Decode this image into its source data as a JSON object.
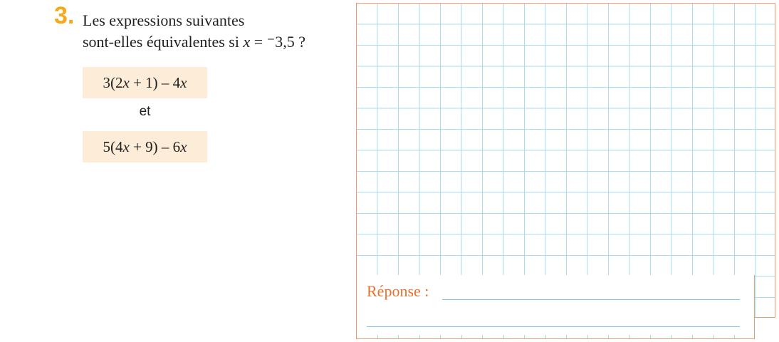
{
  "exercise": {
    "number": "3.",
    "question_line1": "Les expressions suivantes",
    "question_line2_prefix": "sont-elles équivalentes si ",
    "variable": "x",
    "question_line2_equals": " = ",
    "value": "⁻3,5",
    "question_mark": " ?"
  },
  "expressions": {
    "first": {
      "lead": "3(2",
      "var1": "x",
      "mid": " + 1) – 4",
      "var2": "x"
    },
    "connector": "et",
    "second": {
      "lead": "5(4",
      "var1": "x",
      "mid": " + 9) – 6",
      "var2": "x"
    }
  },
  "answer": {
    "label": "Réponse :"
  },
  "colors": {
    "number": "#f4a81c",
    "expression_background": "#fdecd8",
    "grid_lines": "#a9dcef",
    "frame_border": "#ee9a6e",
    "answer_label": "#e8712d"
  }
}
